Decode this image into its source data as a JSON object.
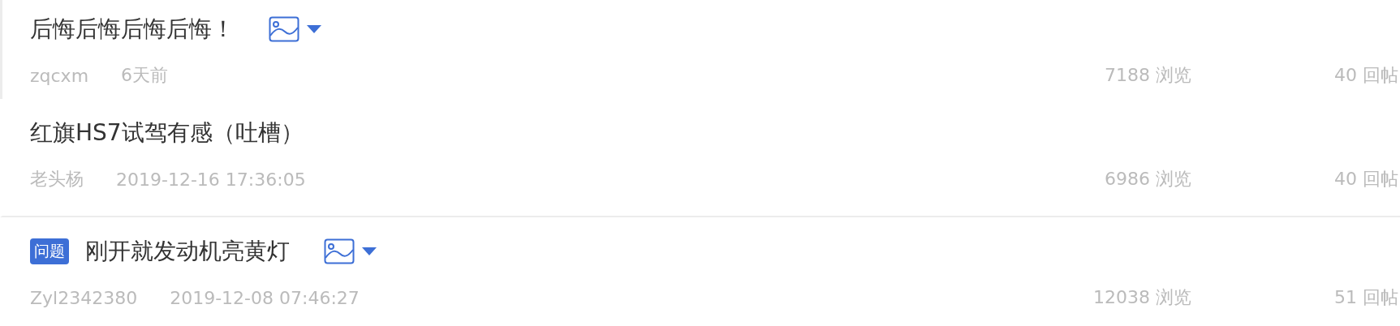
{
  "posts": [
    {
      "title": "后悔后悔后悔后悔！",
      "has_image": true,
      "selected": true,
      "author": "zqcxm",
      "time": "6天前",
      "views": "7188 浏览",
      "replies": "40 回帖"
    },
    {
      "title": "红旗HS7试驾有感（吐槽）",
      "has_image": false,
      "selected": false,
      "author": "老头杨",
      "time": "2019-12-16 17:36:05",
      "views": "6986 浏览",
      "replies": "40 回帖"
    },
    {
      "tag": "问题",
      "title": "刚开就发动机亮黄灯",
      "has_image": true,
      "selected": false,
      "author": "Zyl2342380",
      "time": "2019-12-08 07:46:27",
      "views": "12038 浏览",
      "replies": "51 回帖"
    }
  ]
}
